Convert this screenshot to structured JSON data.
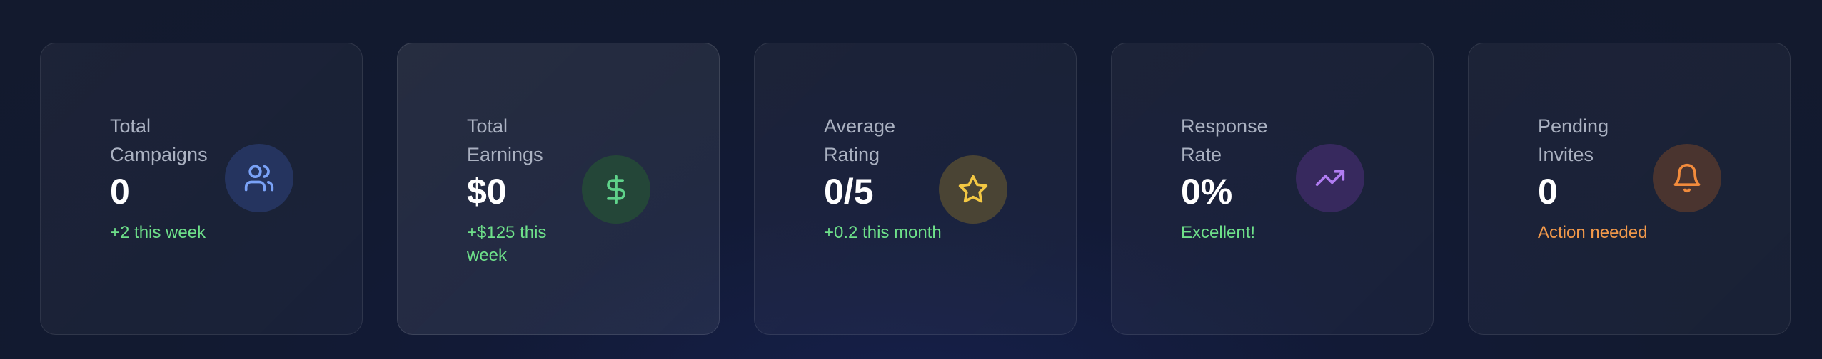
{
  "stats": [
    {
      "label": "Total Campaigns",
      "value": "0",
      "change": "+2 this week",
      "change_color": "#6ee08a",
      "icon": "users-icon",
      "icon_color": "#7aa2f7",
      "icon_bg": "#25345f"
    },
    {
      "label": "Total Earnings",
      "value": "$0",
      "change": "+$125 this week",
      "change_color": "#6ee08a",
      "icon": "dollar-icon",
      "icon_color": "#5fd38a",
      "icon_bg": "#244638"
    },
    {
      "label": "Average Rating",
      "value": "0/5",
      "change": "+0.2 this month",
      "change_color": "#6ee08a",
      "icon": "star-icon",
      "icon_color": "#f3c843",
      "icon_bg": "#4a4434"
    },
    {
      "label": "Response Rate",
      "value": "0%",
      "change": "Excellent!",
      "change_color": "#6ee08a",
      "icon": "trending-up-icon",
      "icon_color": "#b07cf2",
      "icon_bg": "#37295e"
    },
    {
      "label": "Pending Invites",
      "value": "0",
      "change": "Action needed",
      "change_color": "#f2994a",
      "icon": "bell-icon",
      "icon_color": "#f28b3c",
      "icon_bg": "#4a342f"
    }
  ]
}
